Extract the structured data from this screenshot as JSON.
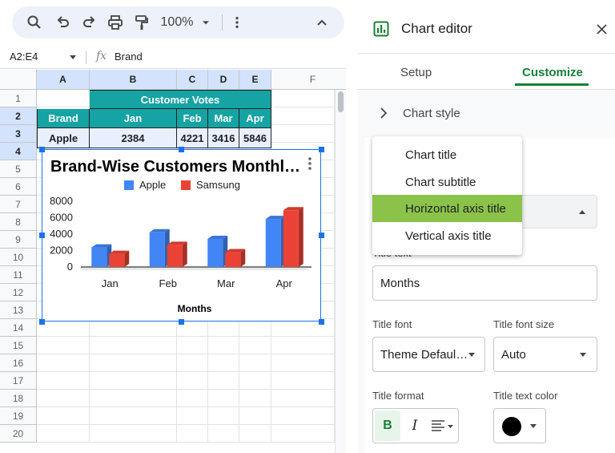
{
  "toolbar": {
    "zoom": "100%"
  },
  "formula_bar": {
    "name_box": "A2:E4",
    "fx": "fx",
    "value": "Brand"
  },
  "grid": {
    "columns": [
      "A",
      "B",
      "C",
      "D",
      "E",
      "F"
    ],
    "rows": [
      "1",
      "2",
      "3",
      "4",
      "5",
      "6",
      "7",
      "8",
      "9",
      "10",
      "11",
      "12",
      "13",
      "14",
      "15",
      "16",
      "17",
      "18",
      "19",
      "20"
    ],
    "merged_title": "Customer Votes",
    "headers": [
      "Brand",
      "Jan",
      "Feb",
      "Mar",
      "Apr"
    ],
    "row3": [
      "Apple",
      "2384",
      "4221",
      "3416",
      "5846"
    ]
  },
  "chart_data": {
    "type": "bar",
    "title": "Brand-Wise Customers Monthl…",
    "categories": [
      "Jan",
      "Feb",
      "Mar",
      "Apr"
    ],
    "series": [
      {
        "name": "Apple",
        "values": [
          2384,
          4221,
          3416,
          5846
        ],
        "color": "#4285f4"
      },
      {
        "name": "Samsung",
        "values": [
          1600,
          2700,
          1800,
          6900
        ],
        "color": "#ea4335"
      }
    ],
    "xlabel": "Months",
    "ylabel": "",
    "yticks": [
      "8000",
      "6000",
      "4000",
      "2000",
      "0"
    ],
    "ylim": [
      0,
      8000
    ],
    "legend": "top",
    "style": "3d"
  },
  "panel": {
    "title": "Chart editor",
    "tabs": [
      "Setup",
      "Customize"
    ],
    "active_tab": "Customize",
    "section": "Chart style",
    "menu_items": [
      "Chart title",
      "Chart subtitle",
      "Horizontal axis title",
      "Vertical axis title"
    ],
    "selected_menu": "Horizontal axis title",
    "title_text_label": "Title text",
    "title_text_value": "Months",
    "title_font_label": "Title font",
    "title_font_value": "Theme Defaul…",
    "title_font_size_label": "Title font size",
    "title_font_size_value": "Auto",
    "title_format_label": "Title format",
    "bold_label": "B",
    "italic_label": "I",
    "title_text_color_label": "Title text color",
    "title_text_color": "#000000"
  }
}
